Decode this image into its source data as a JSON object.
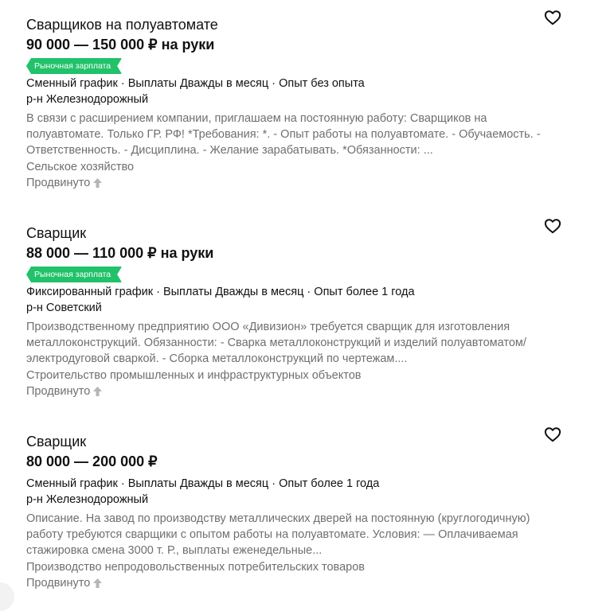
{
  "vacancies": [
    {
      "title": "Сварщиков на полуавтомате",
      "salary": "90 000 — 150 000 ₽ на руки",
      "badge": "Рыночная зарплата",
      "conditions": "Сменный график · Выплаты Дважды в месяц · Опыт без опыта",
      "district": "р-н Железнодорожный",
      "description": "В связи с расширением компании, приглашаем на постоянную работу: Сварщиков на полуавтомате. Только ГР. РФ! *Требования: *. - Опыт работы на полуавтомате. - Обучаемость. - Ответственность. - Дисциплина. - Желание зарабатывать. *Обязанности: ...",
      "category": "Сельское хозяйство",
      "promoted": "Продвинуто"
    },
    {
      "title": "Сварщик",
      "salary": "88 000 — 110 000 ₽ на руки",
      "badge": "Рыночная зарплата",
      "conditions": "Фиксированный график · Выплаты Дважды в месяц · Опыт более 1 года",
      "district": "р-н Советский",
      "description": "Производственному предприятию ООО «Дивизион» требуется сварщик для изготовления металлоконструкций. Обязанности: - Сварка металлоконструкций и изделий полуавтоматом/электродуговой сваркой. - Сборка металлоконструкций по чертежам....",
      "category": "Строительство промышленных и инфраструктурных объектов",
      "promoted": "Продвинуто"
    },
    {
      "title": "Сварщик",
      "salary": "80 000 — 200 000 ₽",
      "conditions": "Сменный график · Выплаты Дважды в месяц · Опыт более 1 года",
      "district": "р-н Железнодорожный",
      "description": "Описание. На завод по производству металлических дверей на постоянную (круглогодичную) работу требуются сварщики с опытом работы на полуавтомате. Условия: — Оплачиваемая стажировка смена 3000 т. Р., выплаты еженедельные...",
      "category": "Производство непродовольственных потребительских товаров",
      "promoted": "Продвинуто"
    }
  ],
  "icons": {
    "favorite": "heart-outline-icon",
    "promoted": "arrow-up-icon"
  },
  "colors": {
    "badge_green": "#21c26a",
    "text_muted": "#6f6f6f",
    "text_main": "#111111"
  }
}
